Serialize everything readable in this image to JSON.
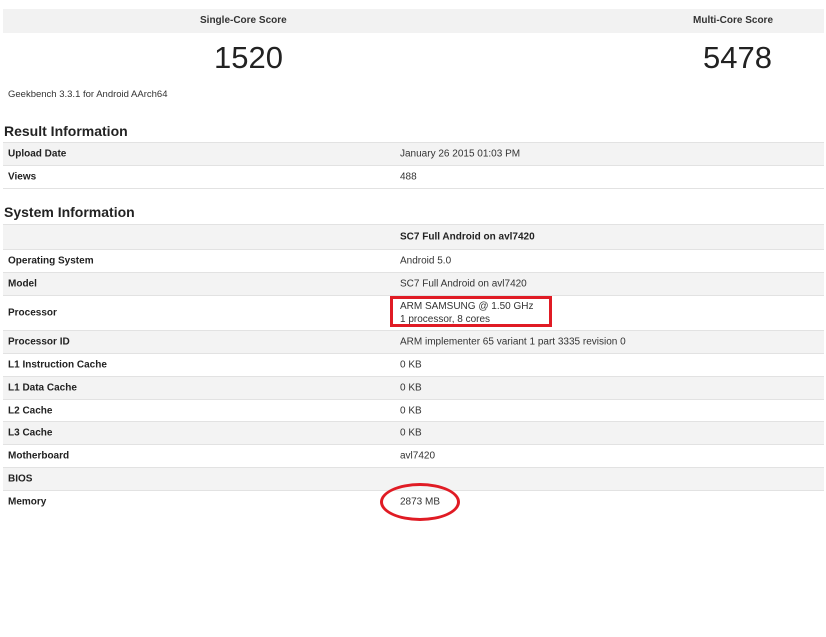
{
  "scores": {
    "single_label": "Single-Core Score",
    "single_value": "1520",
    "multi_label": "Multi-Core Score",
    "multi_value": "5478",
    "version": "Geekbench 3.3.1 for Android AArch64"
  },
  "result_info": {
    "title": "Result Information",
    "rows": [
      {
        "key": "Upload Date",
        "value": "January 26 2015 01:03 PM"
      },
      {
        "key": "Views",
        "value": "488"
      }
    ]
  },
  "system_info": {
    "title": "System Information",
    "header_value": "SC7 Full Android on avl7420",
    "rows": [
      {
        "key": "Operating System",
        "value": "Android 5.0"
      },
      {
        "key": "Model",
        "value": "SC7 Full Android on avl7420"
      },
      {
        "key": "Processor",
        "value": "ARM SAMSUNG @ 1.50 GHz",
        "value2": "1 processor, 8 cores"
      },
      {
        "key": "Processor ID",
        "value": "ARM implementer 65 variant 1 part 3335 revision 0"
      },
      {
        "key": "L1 Instruction Cache",
        "value": "0 KB"
      },
      {
        "key": "L1 Data Cache",
        "value": "0 KB"
      },
      {
        "key": "L2 Cache",
        "value": "0 KB"
      },
      {
        "key": "L3 Cache",
        "value": "0 KB"
      },
      {
        "key": "Motherboard",
        "value": "avl7420"
      },
      {
        "key": "BIOS",
        "value": ""
      },
      {
        "key": "Memory",
        "value": "2873 MB"
      }
    ]
  },
  "annotation_color": "#e01b24"
}
